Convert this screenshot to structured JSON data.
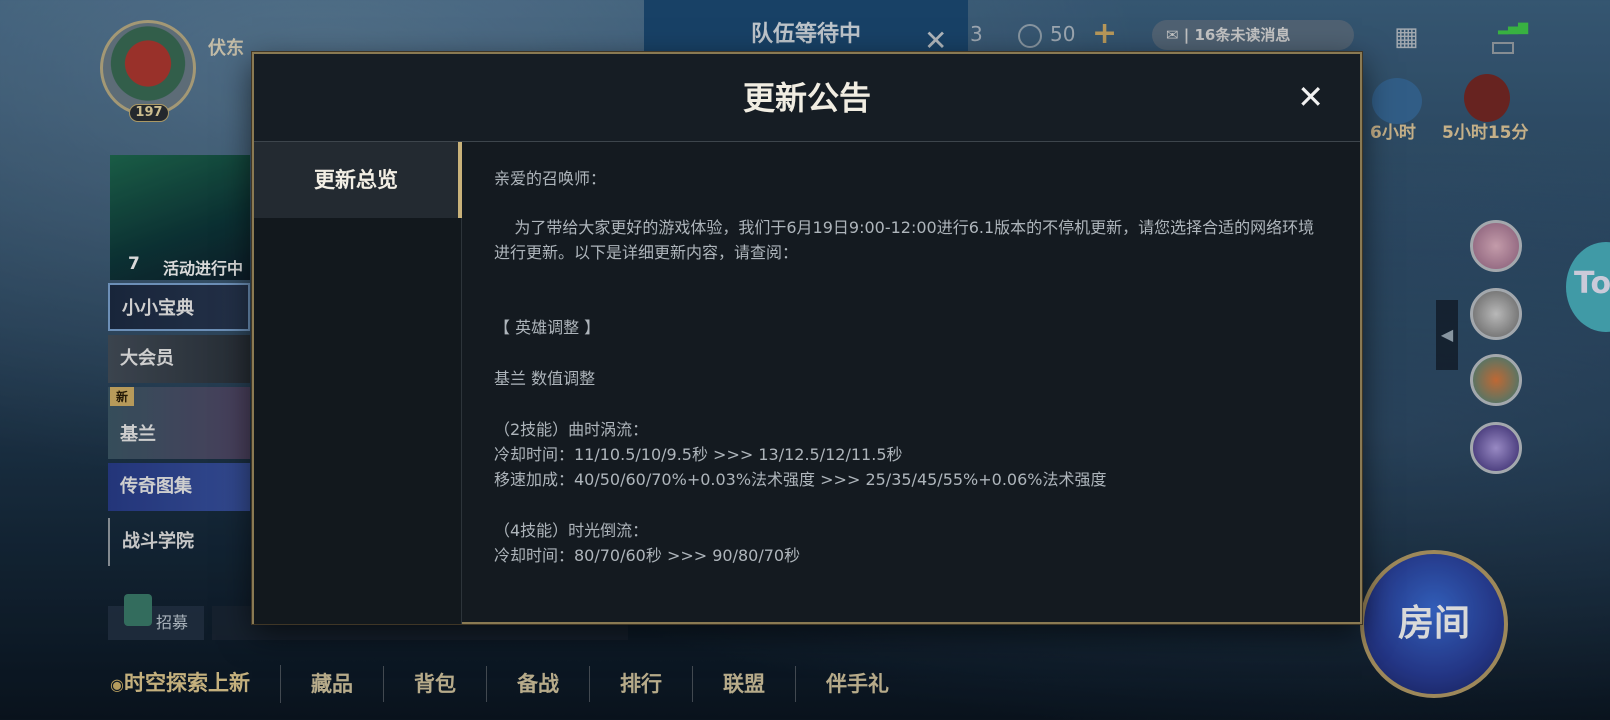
{
  "player": {
    "name": "伏东",
    "level": "197"
  },
  "topbar": {
    "team_status": "队伍等待中",
    "team_close": "✕",
    "currency_count": "50",
    "currency_partial": "3",
    "currency_add": "+",
    "unread_messages": "16条未读消息"
  },
  "sidebar": {
    "activity_count": "7",
    "activity_label": "活动进行中",
    "items": [
      {
        "label": "小小宝典"
      },
      {
        "label": "大会员"
      },
      {
        "label": "基兰",
        "badge": "新"
      },
      {
        "label": "传奇图集"
      },
      {
        "label": "战斗学院"
      }
    ],
    "recruit_label": "招募"
  },
  "right": {
    "heart_timer": "6小时",
    "coupon_timer": "5小时15分",
    "room_button": "房间",
    "edge_partial_text": "To"
  },
  "bottom_nav": [
    {
      "label": "时空探索上新"
    },
    {
      "label": "藏品"
    },
    {
      "label": "背包"
    },
    {
      "label": "备战"
    },
    {
      "label": "排行"
    },
    {
      "label": "联盟"
    },
    {
      "label": "伴手礼"
    }
  ],
  "modal": {
    "title": "更新公告",
    "close_label": "✕",
    "tabs": [
      {
        "label": "更新总览"
      }
    ],
    "content": {
      "greeting": "亲爱的召唤师：",
      "intro": "    为了带给大家更好的游戏体验，我们于6月19日9:00-12:00进行6.1版本的不停机更新，请您选择合适的网络环境进行更新。以下是详细更新内容，请查阅：",
      "section_heading": "【 英雄调整 】",
      "hero_line": "基兰 数值调整",
      "skill2_title": "（2技能）曲时涡流：",
      "skill2_cd": "冷却时间：11/10.5/10/9.5秒 >>> 13/12.5/12/11.5秒",
      "skill2_speed": "移速加成：40/50/60/70%+0.03%法术强度 >>> 25/35/45/55%+0.06%法术强度",
      "skill4_title": "（4技能）时光倒流：",
      "skill4_cd": "冷却时间：80/70/60秒 >>> 90/80/70秒"
    }
  },
  "colors": {
    "modal_border": "#8a7a53",
    "tab_accent": "#c9b27a",
    "team_banner": "#1d4d78",
    "legend_item": "#3c57a8"
  }
}
